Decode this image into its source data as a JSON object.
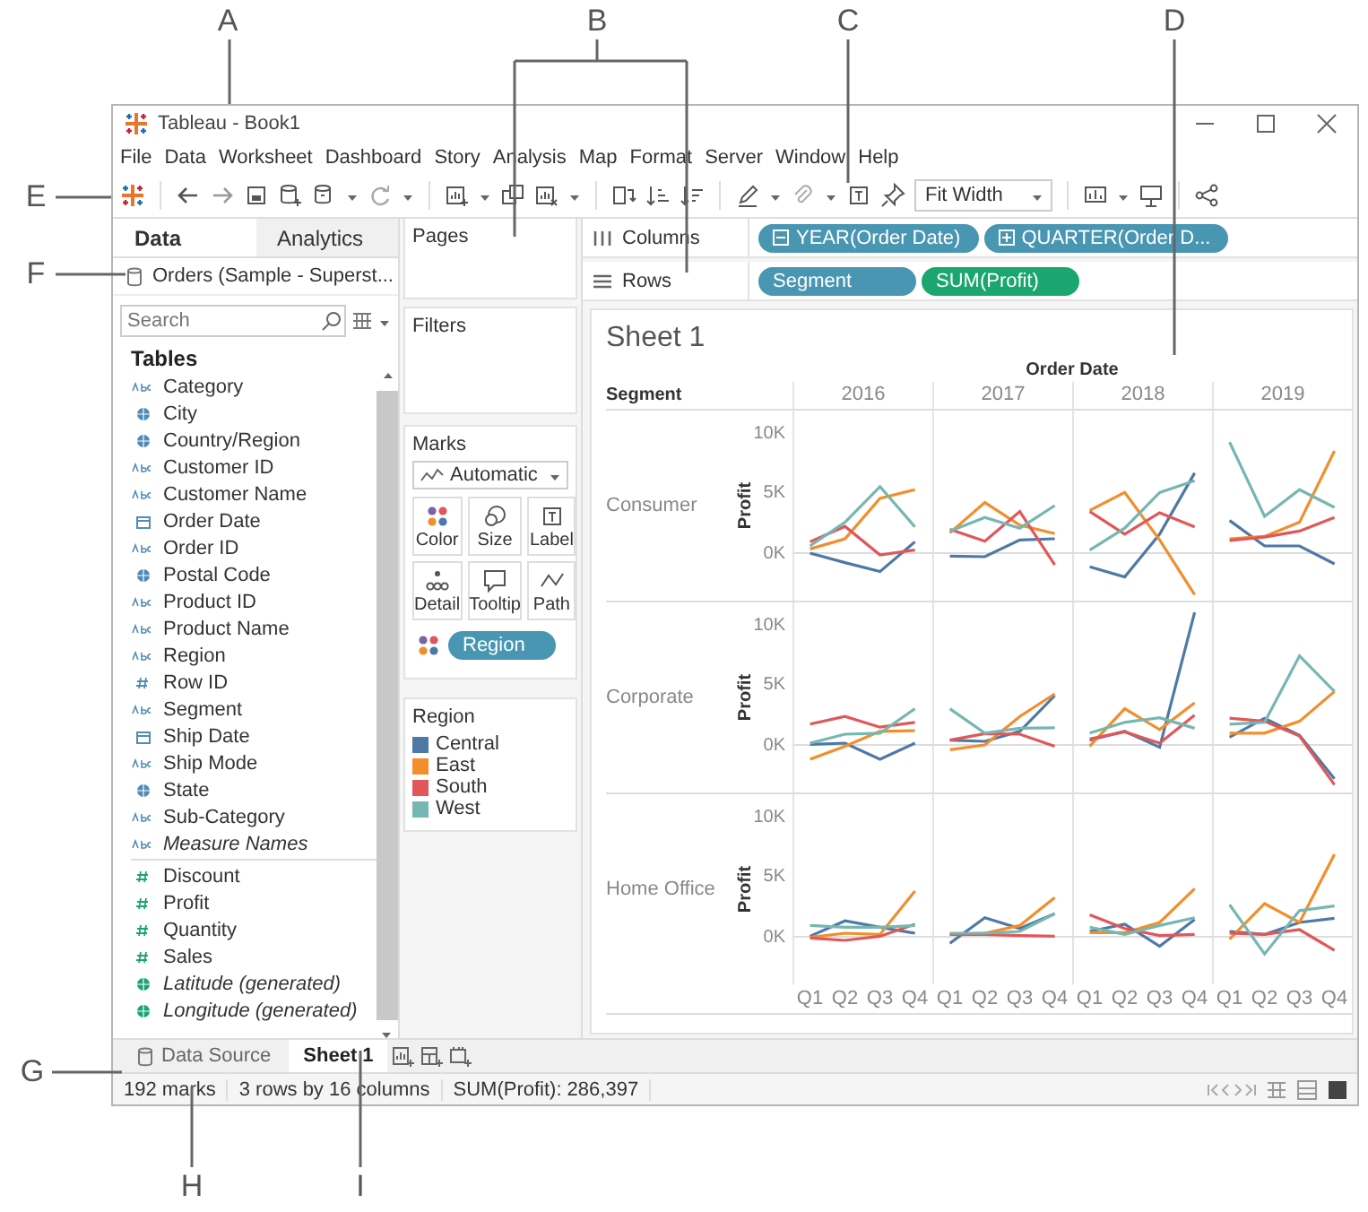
{
  "window": {
    "title": "Tableau - Book1"
  },
  "menu": [
    "File",
    "Data",
    "Worksheet",
    "Dashboard",
    "Story",
    "Analysis",
    "Map",
    "Format",
    "Server",
    "Window",
    "Help"
  ],
  "toolbar": {
    "fit": "Fit Width"
  },
  "data_pane": {
    "tabs": [
      {
        "label": "Data",
        "selected": true
      },
      {
        "label": "Analytics",
        "selected": false
      }
    ],
    "data_source": "Orders (Sample - Superst...",
    "search": {
      "placeholder": "Search"
    },
    "heading": "Tables",
    "fields": [
      {
        "label": "Category",
        "kind": "string",
        "measure": false,
        "italic": false
      },
      {
        "label": "City",
        "kind": "geo",
        "measure": false,
        "italic": false
      },
      {
        "label": "Country/Region",
        "kind": "geo",
        "measure": false,
        "italic": false
      },
      {
        "label": "Customer ID",
        "kind": "string",
        "measure": false,
        "italic": false
      },
      {
        "label": "Customer Name",
        "kind": "string",
        "measure": false,
        "italic": false
      },
      {
        "label": "Order Date",
        "kind": "date",
        "measure": false,
        "italic": false
      },
      {
        "label": "Order ID",
        "kind": "string",
        "measure": false,
        "italic": false
      },
      {
        "label": "Postal Code",
        "kind": "geo",
        "measure": false,
        "italic": false
      },
      {
        "label": "Product ID",
        "kind": "string",
        "measure": false,
        "italic": false
      },
      {
        "label": "Product Name",
        "kind": "string",
        "measure": false,
        "italic": false
      },
      {
        "label": "Region",
        "kind": "string",
        "measure": false,
        "italic": false
      },
      {
        "label": "Row ID",
        "kind": "number",
        "measure": false,
        "italic": false
      },
      {
        "label": "Segment",
        "kind": "string",
        "measure": false,
        "italic": false
      },
      {
        "label": "Ship Date",
        "kind": "date",
        "measure": false,
        "italic": false
      },
      {
        "label": "Ship Mode",
        "kind": "string",
        "measure": false,
        "italic": false
      },
      {
        "label": "State",
        "kind": "geo",
        "measure": false,
        "italic": false
      },
      {
        "label": "Sub-Category",
        "kind": "string",
        "measure": false,
        "italic": false
      },
      {
        "label": "Measure Names",
        "kind": "string",
        "measure": false,
        "italic": true
      },
      {
        "label": "Discount",
        "kind": "number",
        "measure": true,
        "italic": false
      },
      {
        "label": "Profit",
        "kind": "number",
        "measure": true,
        "italic": false
      },
      {
        "label": "Quantity",
        "kind": "number",
        "measure": true,
        "italic": false
      },
      {
        "label": "Sales",
        "kind": "number",
        "measure": true,
        "italic": false
      },
      {
        "label": "Latitude (generated)",
        "kind": "geo",
        "measure": true,
        "italic": true
      },
      {
        "label": "Longitude (generated)",
        "kind": "geo",
        "measure": true,
        "italic": true
      }
    ]
  },
  "pages": {
    "title": "Pages"
  },
  "filters": {
    "title": "Filters"
  },
  "marks": {
    "title": "Marks",
    "mark_type": "Automatic",
    "buttons": [
      {
        "kind": "color",
        "label": "Color"
      },
      {
        "kind": "size",
        "label": "Size"
      },
      {
        "kind": "label",
        "label": "Label"
      },
      {
        "kind": "detail",
        "label": "Detail"
      },
      {
        "kind": "tooltip",
        "label": "Tooltip"
      },
      {
        "kind": "path",
        "label": "Path"
      }
    ],
    "pills": [
      {
        "kind": "color",
        "label": "Region"
      }
    ]
  },
  "legend": {
    "title": "Region",
    "items": [
      {
        "label": "Central",
        "color": "#4e79a7"
      },
      {
        "label": "East",
        "color": "#f28e2b"
      },
      {
        "label": "South",
        "color": "#e15759"
      },
      {
        "label": "West",
        "color": "#76b7b2"
      }
    ]
  },
  "shelves": [
    {
      "label": "Columns",
      "kind": "columns",
      "pills": [
        {
          "label": "YEAR(Order Date)",
          "kind": "discrete",
          "expanded": true
        },
        {
          "label": "QUARTER(Order D...",
          "kind": "discrete",
          "expanded": false
        }
      ]
    },
    {
      "label": "Rows",
      "kind": "rows",
      "pills": [
        {
          "label": "Segment",
          "kind": "discrete"
        },
        {
          "label": "SUM(Profit)",
          "kind": "continuous"
        }
      ]
    }
  ],
  "view": {
    "title": "Sheet 1",
    "column_header": "Order Date",
    "row_header": "Segment",
    "columns": [
      {
        "label": "2016"
      },
      {
        "label": "2017"
      },
      {
        "label": "2018"
      },
      {
        "label": "2019"
      }
    ],
    "rows": [
      {
        "label": "Consumer",
        "axis_title": "Profit",
        "chart_data": {
          "type": "line",
          "ylim": [
            -4,
            12
          ],
          "categories": [
            null,
            null,
            null,
            null,
            null,
            null,
            null,
            null,
            null,
            null,
            null,
            null,
            null,
            null,
            null,
            null
          ],
          "yticks": [
            {
              "value": 0,
              "label": "0K"
            },
            {
              "value": 5,
              "label": "5K"
            },
            {
              "value": 10,
              "label": "10K"
            }
          ],
          "series": [
            {
              "color": "#4e79a7",
              "values": [
                0,
                -0.8,
                -1.55,
                0.95,
                -0.25,
                -0.3,
                1.1,
                1.2,
                -1.15,
                -2.0,
                1.6,
                6.75,
                2.75,
                0.6,
                0.6,
                -0.9
              ]
            },
            {
              "color": "#f28e2b",
              "values": [
                0.35,
                1.2,
                4.6,
                5.35,
                1.7,
                4.25,
                2.35,
                1.65,
                3.6,
                5.1,
                1.1,
                -3.5,
                1.2,
                1.4,
                2.6,
                8.6
              ]
            },
            {
              "color": "#e15759",
              "values": [
                0.95,
                2.25,
                -0.15,
                0.25,
                2.0,
                1.0,
                3.5,
                -1.0,
                3.5,
                1.6,
                3.4,
                2.2,
                1.05,
                1.35,
                1.85,
                3.0
              ]
            },
            {
              "color": "#76b7b2",
              "values": [
                0.6,
                2.6,
                5.6,
                2.2,
                1.85,
                3.0,
                2.1,
                4.0,
                0.25,
                2.1,
                5.1,
                6.1,
                9.35,
                3.1,
                5.35,
                3.85
              ]
            }
          ]
        }
      },
      {
        "label": "Corporate",
        "axis_title": "Profit",
        "chart_data": {
          "type": "line",
          "ylim": [
            -4,
            12
          ],
          "categories": [
            null,
            null,
            null,
            null,
            null,
            null,
            null,
            null,
            null,
            null,
            null,
            null,
            null,
            null,
            null,
            null
          ],
          "yticks": [
            {
              "value": 0,
              "label": "0K"
            },
            {
              "value": 5,
              "label": "5K"
            },
            {
              "value": 10,
              "label": "10K"
            }
          ],
          "series": [
            {
              "color": "#4e79a7",
              "values": [
                0.05,
                0.15,
                -1.2,
                0.15,
                0.4,
                0.3,
                1.15,
                4.15,
                0.4,
                1.15,
                -0.2,
                11.15,
                0.65,
                2.25,
                0.8,
                -2.85
              ]
            },
            {
              "color": "#f28e2b",
              "values": [
                -1.2,
                -0.1,
                1.15,
                1.2,
                -0.4,
                0,
                2.4,
                4.3,
                -0.1,
                3.05,
                1.3,
                3.55,
                1.0,
                1.0,
                2.0,
                4.5
              ]
            },
            {
              "color": "#e15759",
              "values": [
                1.75,
                2.4,
                1.5,
                1.9,
                0.4,
                0.95,
                0.9,
                -0.1,
                0.5,
                1.1,
                0.15,
                2.5,
                2.25,
                2.0,
                0.75,
                -3.35
              ]
            },
            {
              "color": "#76b7b2",
              "values": [
                0.15,
                0.9,
                1.0,
                3.05,
                3.05,
                1.0,
                1.4,
                1.45,
                1.0,
                1.9,
                2.3,
                1.4,
                1.75,
                1.9,
                7.5,
                4.5
              ]
            }
          ]
        }
      },
      {
        "label": "Home Office",
        "axis_title": "Profit",
        "chart_data": {
          "type": "line",
          "ylim": [
            -4,
            12
          ],
          "categories": [
            "Q1",
            "Q2",
            "Q3",
            "Q4",
            "Q1",
            "Q2",
            "Q3",
            "Q4",
            "Q1",
            "Q2",
            "Q3",
            "Q4",
            "Q1",
            "Q2",
            "Q3",
            "Q4"
          ],
          "yticks": [
            {
              "value": 0,
              "label": "0K"
            },
            {
              "value": 5,
              "label": "5K"
            },
            {
              "value": 10,
              "label": "10K"
            }
          ],
          "series": [
            {
              "color": "#4e79a7",
              "values": [
                0.05,
                1.35,
                0.8,
                0.3,
                -0.55,
                1.6,
                0.7,
                1.95,
                0.45,
                1.05,
                -0.8,
                1.45,
                0.45,
                0.2,
                1.2,
                1.55
              ]
            },
            {
              "color": "#f28e2b",
              "values": [
                -0.05,
                0.3,
                0.2,
                3.85,
                0.2,
                0.3,
                0.95,
                3.3,
                0.35,
                0.35,
                1.2,
                4.05,
                -0.2,
                2.8,
                1.2,
                6.95
              ]
            },
            {
              "color": "#e15759",
              "values": [
                -0.1,
                -0.3,
                0.05,
                1.05,
                0.2,
                0.2,
                0.1,
                0.05,
                1.85,
                0.7,
                0.1,
                0.2,
                0.3,
                0.2,
                0.6,
                -1.15
              ]
            },
            {
              "color": "#76b7b2",
              "values": [
                0.95,
                0.8,
                0.8,
                0.95,
                0.3,
                0.3,
                0.45,
                1.95,
                0.8,
                0.2,
                0.95,
                1.6,
                2.7,
                -1.45,
                2.2,
                2.6
              ]
            }
          ]
        }
      }
    ]
  },
  "sheet_tabs": [
    {
      "label": "Data Source",
      "kind": "data_source",
      "selected": false
    },
    {
      "label": "Sheet 1",
      "kind": "sheet",
      "selected": true
    }
  ],
  "status_bar": [
    "192 marks",
    "3 rows by 16 columns",
    "SUM(Profit): 286,397"
  ],
  "callouts": [
    "A",
    "B",
    "C",
    "D",
    "E",
    "F",
    "G",
    "H",
    "I"
  ]
}
